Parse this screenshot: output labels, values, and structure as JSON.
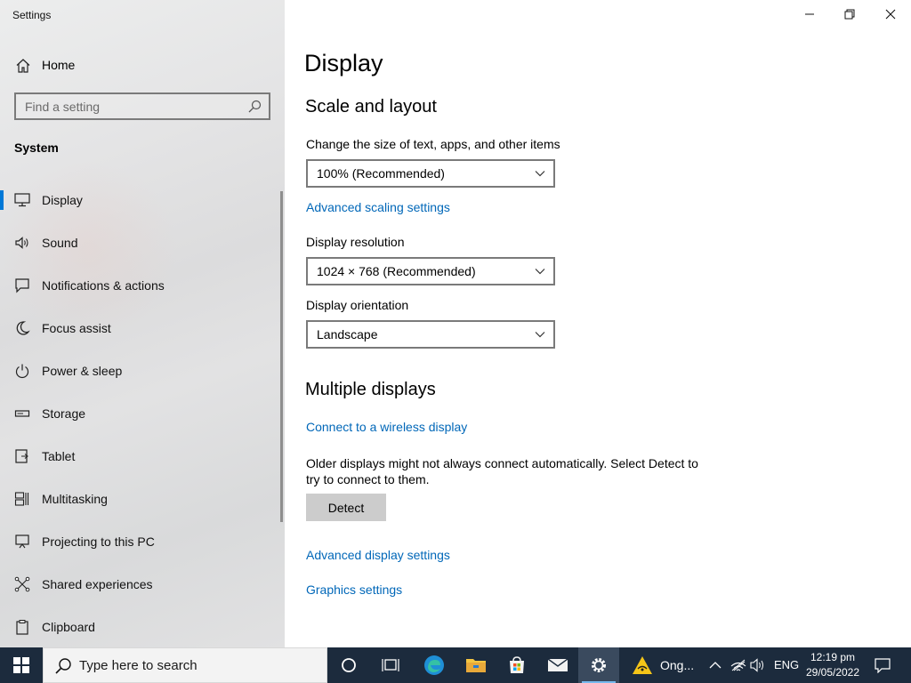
{
  "window": {
    "title": "Settings",
    "controls": {
      "minimize_icon": "minimize-icon",
      "restore_icon": "restore-icon",
      "close_icon": "close-icon"
    }
  },
  "sidebar": {
    "home": {
      "label": "Home",
      "icon": "home-icon"
    },
    "search": {
      "placeholder": "Find a setting",
      "value": ""
    },
    "section": "System",
    "items": [
      {
        "label": "Display",
        "icon": "monitor-icon",
        "active": true
      },
      {
        "label": "Sound",
        "icon": "speaker-icon"
      },
      {
        "label": "Notifications & actions",
        "icon": "notification-icon"
      },
      {
        "label": "Focus assist",
        "icon": "moon-icon"
      },
      {
        "label": "Power & sleep",
        "icon": "power-icon"
      },
      {
        "label": "Storage",
        "icon": "storage-icon"
      },
      {
        "label": "Tablet",
        "icon": "tablet-icon"
      },
      {
        "label": "Multitasking",
        "icon": "multitasking-icon"
      },
      {
        "label": "Projecting to this PC",
        "icon": "projector-icon"
      },
      {
        "label": "Shared experiences",
        "icon": "shared-icon"
      },
      {
        "label": "Clipboard",
        "icon": "clipboard-icon"
      }
    ]
  },
  "main": {
    "title": "Display",
    "scale_section": {
      "heading": "Scale and layout",
      "scale_label": "Change the size of text, apps, and other items",
      "scale_value": "100% (Recommended)",
      "advanced_scaling_link": "Advanced scaling settings",
      "resolution_label": "Display resolution",
      "resolution_value": "1024 × 768 (Recommended)",
      "orientation_label": "Display orientation",
      "orientation_value": "Landscape"
    },
    "multiple_section": {
      "heading": "Multiple displays",
      "wireless_link": "Connect to a wireless display",
      "detect_text": "Older displays might not always connect automatically. Select Detect to try to connect to them.",
      "detect_button": "Detect",
      "advanced_display_link": "Advanced display settings",
      "graphics_link": "Graphics settings"
    }
  },
  "taskbar": {
    "search_placeholder": "Type here to search",
    "notification_app_text": "Ong...",
    "language": "ENG",
    "time": "12:19 pm",
    "date": "29/05/2022",
    "accent_color": "#0078d7",
    "background_color": "#1c2b3d"
  }
}
